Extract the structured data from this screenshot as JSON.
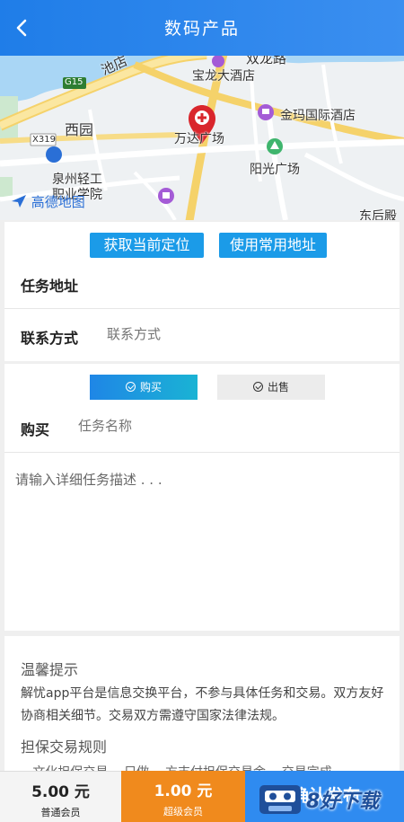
{
  "header": {
    "title": "数码产品"
  },
  "map": {
    "labels": {
      "road_upper": "池店",
      "road_right": "双龙路",
      "baolong": "宝龙大酒店",
      "g15": "G15",
      "jinma": "金玛国际酒店",
      "xiyuan": "西园",
      "wanda": "万达广场",
      "x319": "X319",
      "yangguang": "阳光广场",
      "quanzhou1": "泉州轻工",
      "quanzhou2": "职业学院",
      "bottom_right": "东后殿"
    },
    "logo_text": "高德地图"
  },
  "location": {
    "get_current_label": "获取当前定位",
    "use_common_label": "使用常用地址",
    "address_label": "任务地址",
    "contact_label": "联系方式",
    "contact_placeholder": "联系方式"
  },
  "task": {
    "buy_label": "购买",
    "sell_label": "出售",
    "type_label": "购买",
    "name_placeholder": "任务名称",
    "desc_placeholder": "请输入详细任务描述 . . ."
  },
  "tips": {
    "heading": "温馨提示",
    "body": " 解忧app平台是信息交换平台，不参与具体任务和交易。双方友好协商相关细节。交易双方需遵守国家法律法规。",
    "rules_heading": "担保交易规则",
    "rules_partial": "   ...文化担保交易  ...只做  ...方支付担保交易金 ...交易完成..."
  },
  "footer": {
    "normal_price": "5.00 元",
    "normal_name": "普通会员",
    "super_price": "1.00 元",
    "super_name": "超级会员",
    "confirm_label": "确认发布",
    "watermark": "8好下载"
  },
  "colors": {
    "primary": "#1f7de8",
    "button_blue": "#1b9be8",
    "orange": "#f08a1d",
    "marker_red": "#d9262c",
    "poi_purple": "#a45bd6",
    "poi_green": "#3fb56d"
  }
}
